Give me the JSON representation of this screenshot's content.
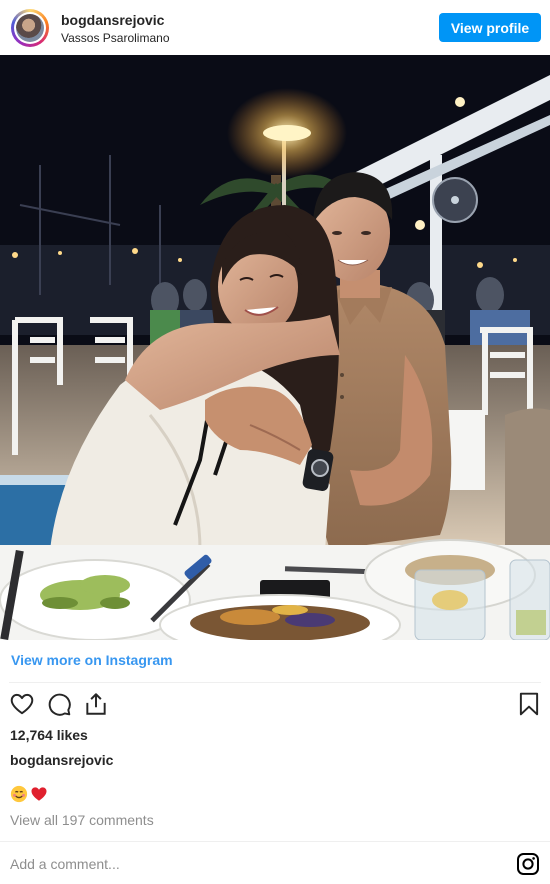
{
  "header": {
    "username": "bogdansrejovic",
    "location": "Vassos Psarolimano",
    "view_profile_label": "View profile"
  },
  "post": {
    "view_more_label": "View more on Instagram",
    "likes": "12,764 likes",
    "caption_username": "bogdansrejovic",
    "caption_emojis": [
      "smiling-face-with-hearts",
      "red-heart"
    ],
    "view_comments_label": "View all 197 comments",
    "add_comment_placeholder": "Add a comment..."
  },
  "colors": {
    "accent": "#0095f6",
    "link": "#3897f0",
    "muted": "#8e8e8e",
    "text": "#262626"
  },
  "icons": [
    "heart-icon",
    "comment-icon",
    "share-icon",
    "bookmark-icon",
    "instagram-icon"
  ]
}
